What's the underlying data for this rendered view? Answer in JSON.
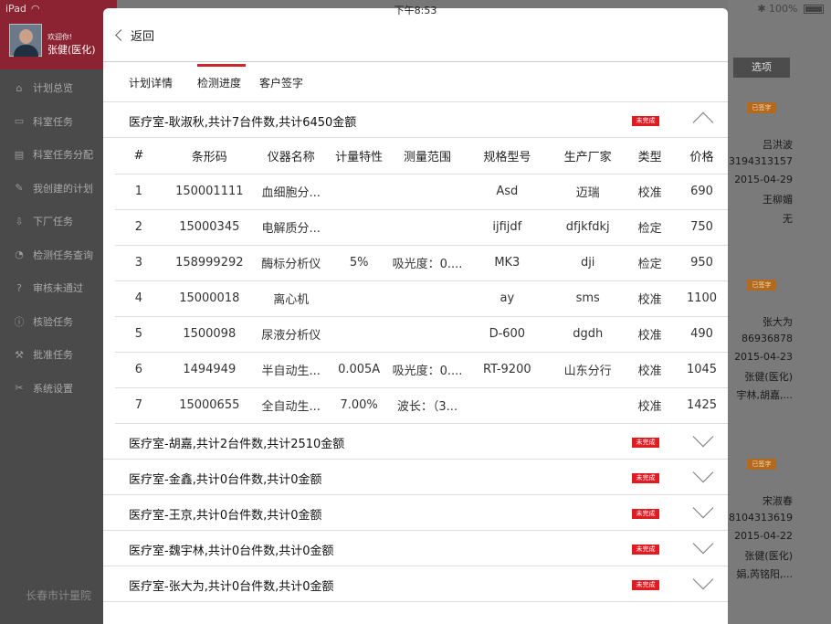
{
  "status_bar": {
    "device": "iPad",
    "time": "下午8:53",
    "battery": "100%"
  },
  "sidebar": {
    "welcome": "欢迎你!",
    "user_name": "张健(医化)",
    "items": [
      {
        "label": "计划总览",
        "icon": "home-icon"
      },
      {
        "label": "科室任务",
        "icon": "wallet-icon"
      },
      {
        "label": "科室任务分配",
        "icon": "inbox-icon"
      },
      {
        "label": "我创建的计划",
        "icon": "edit-icon"
      },
      {
        "label": "下厂任务",
        "icon": "download-icon"
      },
      {
        "label": "检测任务查询",
        "icon": "clock-icon"
      },
      {
        "label": "审核未通过",
        "icon": "question-icon"
      },
      {
        "label": "核验任务",
        "icon": "info-icon"
      },
      {
        "label": "批准任务",
        "icon": "gavel-icon"
      },
      {
        "label": "系统设置",
        "icon": "wrench-icon"
      }
    ],
    "footer": "长春市计量院"
  },
  "background": {
    "select_label": "选项",
    "badge_label": "已签字",
    "cards": [
      {
        "lines": [
          "吕洪波",
          "13194313157",
          "2015-04-29",
          "王柳媚",
          "无"
        ]
      },
      {
        "lines": [
          "张大为",
          "86936878",
          "2015-04-23",
          "张健(医化)",
          "宇林,胡嘉,..."
        ]
      },
      {
        "lines": [
          "宋淑春",
          "18104313619",
          "2015-04-22",
          "张健(医化)",
          "娟,芮铭阳,..."
        ]
      }
    ]
  },
  "modal": {
    "back_label": "返回",
    "tabs": [
      {
        "label": "计划详情",
        "active": false
      },
      {
        "label": "检测进度",
        "active": true
      },
      {
        "label": "客户签字",
        "active": false
      }
    ],
    "status_label": "未完成",
    "table_headers": [
      "#",
      "条形码",
      "仪器名称",
      "计量特性",
      "测量范围",
      "规格型号",
      "生产厂家",
      "类型",
      "价格"
    ],
    "groups": [
      {
        "title": "医疗室-耿淑秋,共计7台件数,共计6450金额",
        "expanded": true,
        "rows": [
          [
            "1",
            "150001111",
            "血细胞分...",
            "",
            "",
            "Asd",
            "迈瑞",
            "校准",
            "690"
          ],
          [
            "2",
            "15000345",
            "电解质分...",
            "",
            "",
            "ijfijdf",
            "dfjkfdkj",
            "检定",
            "750"
          ],
          [
            "3",
            "158999292",
            "酶标分析仪",
            "5%",
            "吸光度：0....",
            "MK3",
            "dji",
            "检定",
            "950"
          ],
          [
            "4",
            "15000018",
            "离心机",
            "",
            "",
            "ay",
            "sms",
            "校准",
            "1100"
          ],
          [
            "5",
            "1500098",
            "尿液分析仪",
            "",
            "",
            "D-600",
            "dgdh",
            "校准",
            "490"
          ],
          [
            "6",
            "1494949",
            "半自动生...",
            "0.005A",
            "吸光度：0....",
            "RT-9200",
            "山东分行",
            "校准",
            "1045"
          ],
          [
            "7",
            "15000655",
            "全自动生...",
            "7.00%",
            "波长：（3...",
            "",
            "",
            "校准",
            "1425"
          ]
        ]
      },
      {
        "title": "医疗室-胡嘉,共计2台件数,共计2510金额",
        "expanded": false
      },
      {
        "title": "医疗室-金鑫,共计0台件数,共计0金额",
        "expanded": false
      },
      {
        "title": "医疗室-王京,共计0台件数,共计0金额",
        "expanded": false
      },
      {
        "title": "医疗室-魏宇林,共计0台件数,共计0金额",
        "expanded": false
      },
      {
        "title": "医疗室-张大为,共计0台件数,共计0金额",
        "expanded": false
      }
    ]
  },
  "colors": {
    "accent": "#c9252c",
    "sidebar": "#4a4a4a",
    "profile": "#8b2332",
    "badge": "#e01b22"
  }
}
